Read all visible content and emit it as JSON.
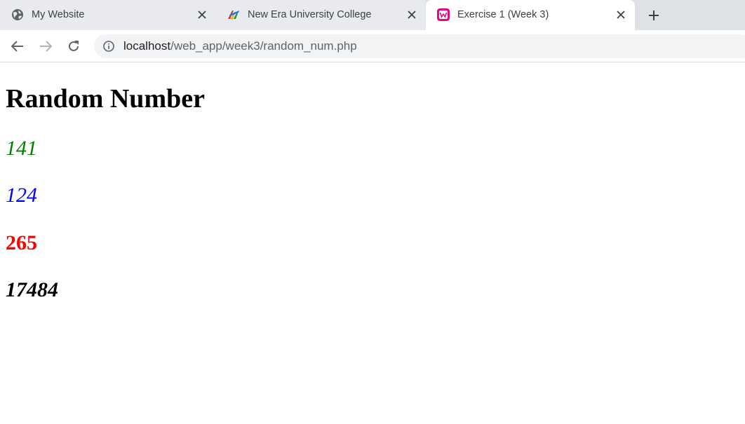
{
  "tabs": [
    {
      "title": "My Website",
      "favicon": "globe-icon"
    },
    {
      "title": "New Era University College",
      "favicon": "neuc-logo-icon"
    },
    {
      "title": "Exercise 1 (Week 3)",
      "favicon": "wampserver-icon",
      "active": true
    }
  ],
  "address_bar": {
    "host": "localhost",
    "path": "/web_app/week3/random_num.php"
  },
  "page": {
    "heading": "Random Number",
    "numbers": [
      {
        "value": "141",
        "color": "#008000",
        "style": "italic"
      },
      {
        "value": "124",
        "color": "#0000ff",
        "style": "italic"
      },
      {
        "value": "265",
        "color": "#ff0000",
        "style": "bold"
      },
      {
        "value": "17484",
        "color": "#000000",
        "style": "bold italic"
      }
    ]
  },
  "colors": {
    "tabstrip": "#dee1e6",
    "active_tab": "#ffffff",
    "accent": "#1a73e8",
    "wamp_pink": "#e6097e"
  }
}
